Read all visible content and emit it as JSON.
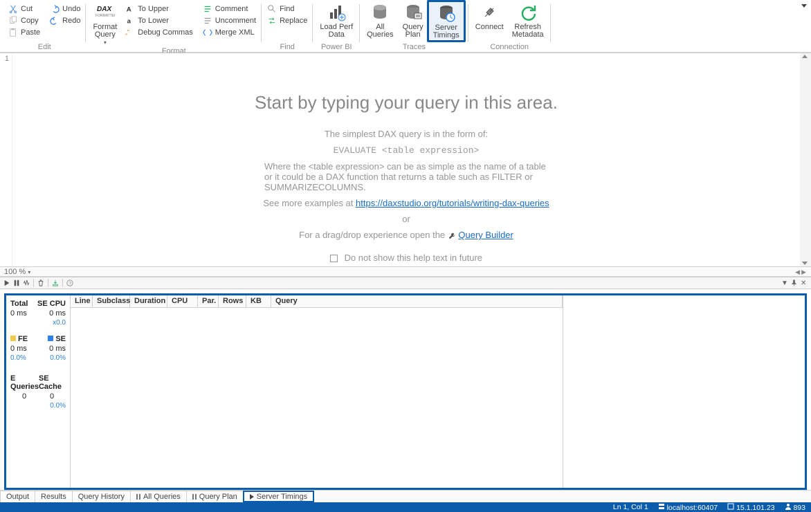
{
  "ribbon": {
    "edit": {
      "cut": "Cut",
      "copy": "Copy",
      "paste": "Paste",
      "undo": "Undo",
      "redo": "Redo",
      "label": "Edit"
    },
    "format": {
      "dax_format": "Format\nQuery",
      "dax_dropdown": "▾",
      "to_upper": "To Upper",
      "to_lower": "To Lower",
      "debug_commas": "Debug Commas",
      "comment": "Comment",
      "uncomment": "Uncomment",
      "merge_xml": "Merge XML",
      "label": "Format"
    },
    "find": {
      "find": "Find",
      "replace": "Replace",
      "label": "Find"
    },
    "powerbi": {
      "load_perf": "Load Perf\nData",
      "label": "Power BI"
    },
    "traces": {
      "all_queries": "All\nQueries",
      "query_plan": "Query\nPlan",
      "server_timings": "Server\nTimings",
      "label": "Traces"
    },
    "connection": {
      "connect": "Connect",
      "refresh_metadata": "Refresh\nMetadata",
      "label": "Connection"
    }
  },
  "editor": {
    "line_number": "1",
    "heading": "Start by typing your query in this area.",
    "intro": "The simplest DAX query is in the form of:",
    "code": "EVALUATE <table expression>",
    "desc": "Where the <table expression> can be as simple as the name of a table or it could be a DAX function that returns a table such as FILTER or SUMMARIZECOLUMNS.",
    "examples_prefix": "See more examples at ",
    "examples_link": "https://daxstudio.org/tutorials/writing-dax-queries",
    "or": "or",
    "drag_prefix": "For a drag/drop experience open the ",
    "query_builder": "Query Builder",
    "suppress": "Do not show this help text in future",
    "zoom": "100 %"
  },
  "timings": {
    "total_lbl": "Total",
    "total_val": "0 ms",
    "secpu_lbl": "SE CPU",
    "secpu_val": "0 ms",
    "secpu_ratio": "x0.0",
    "fe_lbl": "FE",
    "fe_val": "0 ms",
    "fe_pct": "0.0%",
    "se_lbl": "SE",
    "se_val": "0 ms",
    "se_pct": "0.0%",
    "equeries_lbl": "E Queries",
    "equeries_val": "0",
    "secache_lbl": "SE Cache",
    "secache_val": "0",
    "secache_pct": "0.0%",
    "cols": [
      "Line",
      "Subclass",
      "Duration",
      "CPU",
      "Par.",
      "Rows",
      "KB",
      "Query"
    ]
  },
  "tabs": {
    "output": "Output",
    "results": "Results",
    "history": "Query History",
    "all_queries": "All Queries",
    "query_plan": "Query Plan",
    "server_timings": "Server Timings"
  },
  "status": {
    "pos": "Ln 1, Col 1",
    "server": "localhost:60407",
    "version": "15.1.101.23",
    "users": "893"
  }
}
